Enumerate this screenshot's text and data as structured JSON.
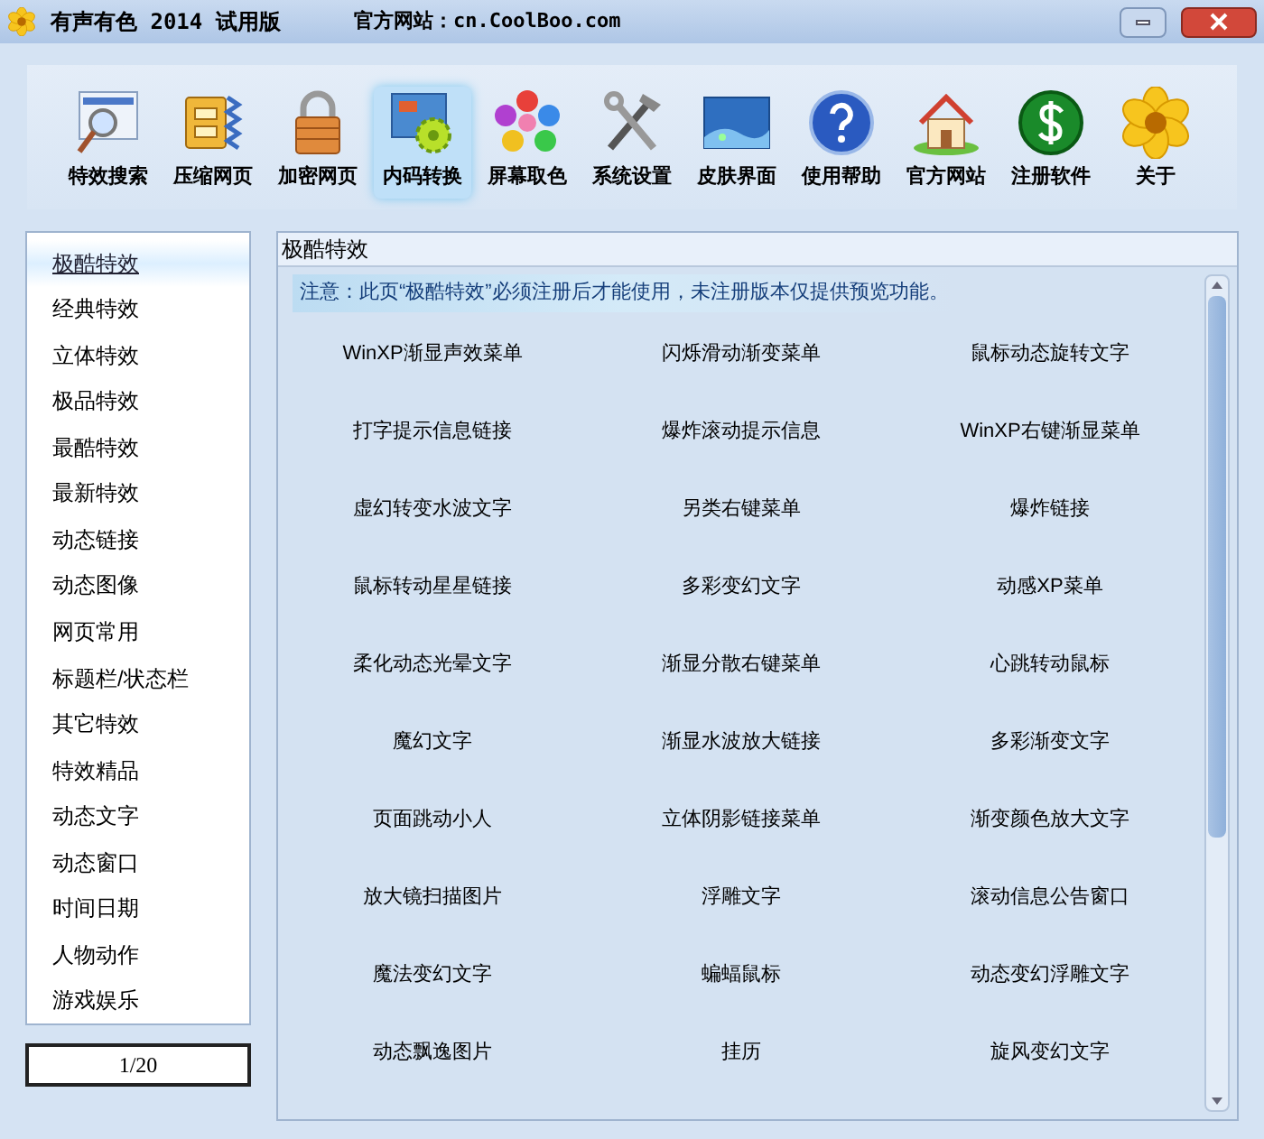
{
  "window": {
    "title": "有声有色 2014 试用版",
    "website": "官方网站：cn.CoolBoo.com"
  },
  "toolbar": [
    {
      "label": "特效搜索",
      "selected": false
    },
    {
      "label": "压缩网页",
      "selected": false
    },
    {
      "label": "加密网页",
      "selected": false
    },
    {
      "label": "内码转换",
      "selected": true
    },
    {
      "label": "屏幕取色",
      "selected": false
    },
    {
      "label": "系统设置",
      "selected": false
    },
    {
      "label": "皮肤界面",
      "selected": false
    },
    {
      "label": "使用帮助",
      "selected": false
    },
    {
      "label": "官方网站",
      "selected": false
    },
    {
      "label": "注册软件",
      "selected": false
    },
    {
      "label": "关于",
      "selected": false
    }
  ],
  "sidebar": {
    "items": [
      {
        "label": "极酷特效",
        "selected": true
      },
      {
        "label": "经典特效",
        "selected": false
      },
      {
        "label": "立体特效",
        "selected": false
      },
      {
        "label": "极品特效",
        "selected": false
      },
      {
        "label": "最酷特效",
        "selected": false
      },
      {
        "label": "最新特效",
        "selected": false
      },
      {
        "label": "动态链接",
        "selected": false
      },
      {
        "label": "动态图像",
        "selected": false
      },
      {
        "label": "网页常用",
        "selected": false
      },
      {
        "label": "标题栏/状态栏",
        "selected": false
      },
      {
        "label": "其它特效",
        "selected": false
      },
      {
        "label": "特效精品",
        "selected": false
      },
      {
        "label": "动态文字",
        "selected": false
      },
      {
        "label": "动态窗口",
        "selected": false
      },
      {
        "label": "时间日期",
        "selected": false
      },
      {
        "label": "人物动作",
        "selected": false
      },
      {
        "label": "游戏娱乐",
        "selected": false
      }
    ],
    "page": "1/20"
  },
  "content": {
    "title": "极酷特效",
    "notice": "注意：此页“极酷特效”必须注册后才能使用，未注册版本仅提供预览功能。",
    "effects": [
      "WinXP渐显声效菜单",
      "闪烁滑动渐变菜单",
      "鼠标动态旋转文字",
      "打字提示信息链接",
      "爆炸滚动提示信息",
      "WinXP右键渐显菜单",
      "虚幻转变水波文字",
      "另类右键菜单",
      "爆炸链接",
      "鼠标转动星星链接",
      "多彩变幻文字",
      "动感XP菜单",
      "柔化动态光晕文字",
      "渐显分散右键菜单",
      "心跳转动鼠标",
      "魔幻文字",
      "渐显水波放大链接",
      "多彩渐变文字",
      "页面跳动小人",
      "立体阴影链接菜单",
      "渐变颜色放大文字",
      "放大镜扫描图片",
      "浮雕文字",
      "滚动信息公告窗口",
      "魔法变幻文字",
      "蝙蝠鼠标",
      "动态变幻浮雕文字",
      "动态飘逸图片",
      "挂历",
      "旋风变幻文字"
    ]
  }
}
